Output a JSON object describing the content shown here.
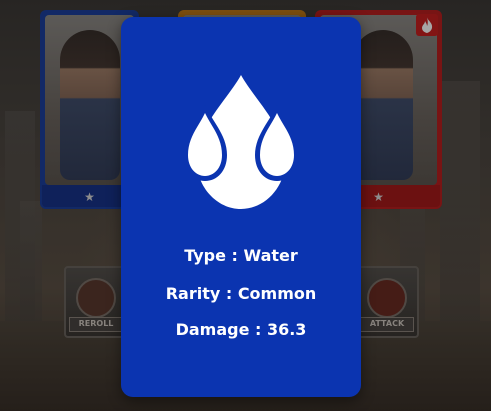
{
  "background": {
    "cards": [
      {
        "element": "water",
        "border_color": "#1d3f9d",
        "star": "★"
      },
      {
        "element": "earth",
        "border_color": "#c17a18",
        "star": "★"
      },
      {
        "element": "fire",
        "border_color": "#b81f1f",
        "star": "★"
      }
    ],
    "buttons": {
      "reroll_label": "REROLL",
      "attack_label": "ATTACK"
    }
  },
  "card_detail": {
    "accent_color": "#0b34b0",
    "icon": "water-drops-icon",
    "type_text": "Type : Water",
    "rarity_text": "Rarity : Common",
    "damage_text": "Damage : 36.3"
  }
}
